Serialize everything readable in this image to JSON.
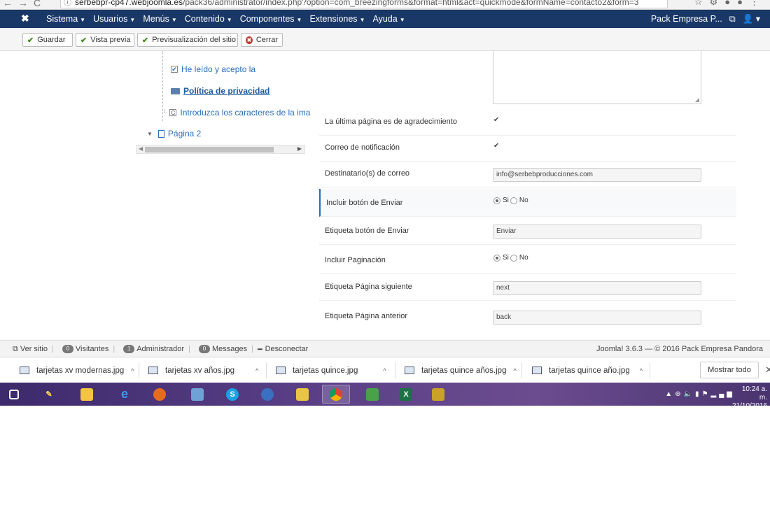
{
  "browser": {
    "url_host": "serbebpr-cp47.webjoomla.es",
    "url_path": "/pack36/administrator/index.php?option=com_breezingforms&format=html&act=quickmode&formName=contacto2&form=3"
  },
  "topmenu": {
    "items": [
      {
        "label": "Sistema"
      },
      {
        "label": "Usuarios"
      },
      {
        "label": "Menús"
      },
      {
        "label": "Contenido"
      },
      {
        "label": "Componentes"
      },
      {
        "label": "Extensiones"
      },
      {
        "label": "Ayuda"
      }
    ],
    "site_name": "Pack Empresa P..."
  },
  "toolbar": {
    "save": "Guardar",
    "preview": "Vista previa",
    "site_preview": "Previsualización del sitio",
    "close": "Cerrar"
  },
  "tree": {
    "item1": "He leído y acepto la",
    "item2": "Política de privacidad",
    "item3": "Introduzca los caracteres de la ima",
    "item3_icon": "C",
    "page2": "Página 2"
  },
  "form": {
    "rows": [
      {
        "label": "La última página es de agradecimiento",
        "type": "checkbox",
        "checked": true
      },
      {
        "label": "Correo de notificación",
        "type": "checkbox",
        "checked": true
      },
      {
        "label": "Destinatario(s) de correo",
        "type": "text",
        "value": "info@serbebproducciones.com"
      },
      {
        "label": "Incluir botón de Enviar",
        "type": "radio",
        "yes": "Si",
        "no": "No",
        "selected": "Si"
      },
      {
        "label": "Etiqueta botón de Enviar",
        "type": "text",
        "value": "Enviar"
      },
      {
        "label": "Incluir Paginación",
        "type": "radio",
        "yes": "Si",
        "no": "No",
        "selected": "Si"
      },
      {
        "label": "Etiqueta Página siguiente",
        "type": "text",
        "value": "next"
      },
      {
        "label": "Etiqueta Página anterior",
        "type": "text",
        "value": "back"
      }
    ]
  },
  "status": {
    "view_site": "Ver sitio",
    "visitors_count": "0",
    "visitors": "Visitantes",
    "admin_count": "1",
    "admin": "Administrador",
    "messages_count": "0",
    "messages": "Messages",
    "logout": "Desconectar",
    "footer": "Joomla! 3.6.3 — © 2016 Pack Empresa Pandora"
  },
  "downloads": {
    "items": [
      {
        "name": "tarjetas xv modernas.jpg"
      },
      {
        "name": "tarjetas xv años.jpg"
      },
      {
        "name": "tarjetas quince.jpg"
      },
      {
        "name": "tarjetas quince años.jpg"
      },
      {
        "name": "tarjetas quince año.jpg"
      }
    ],
    "show_all": "Mostrar todo"
  },
  "taskbar": {
    "apps": [
      "task-view",
      "folder",
      "internet-explorer",
      "firefox",
      "calculator",
      "skype",
      "settings",
      "photos",
      "chrome",
      "image-viewer",
      "excel",
      "paint"
    ],
    "time": "10:24 a. m.",
    "date": "21/10/2016"
  }
}
